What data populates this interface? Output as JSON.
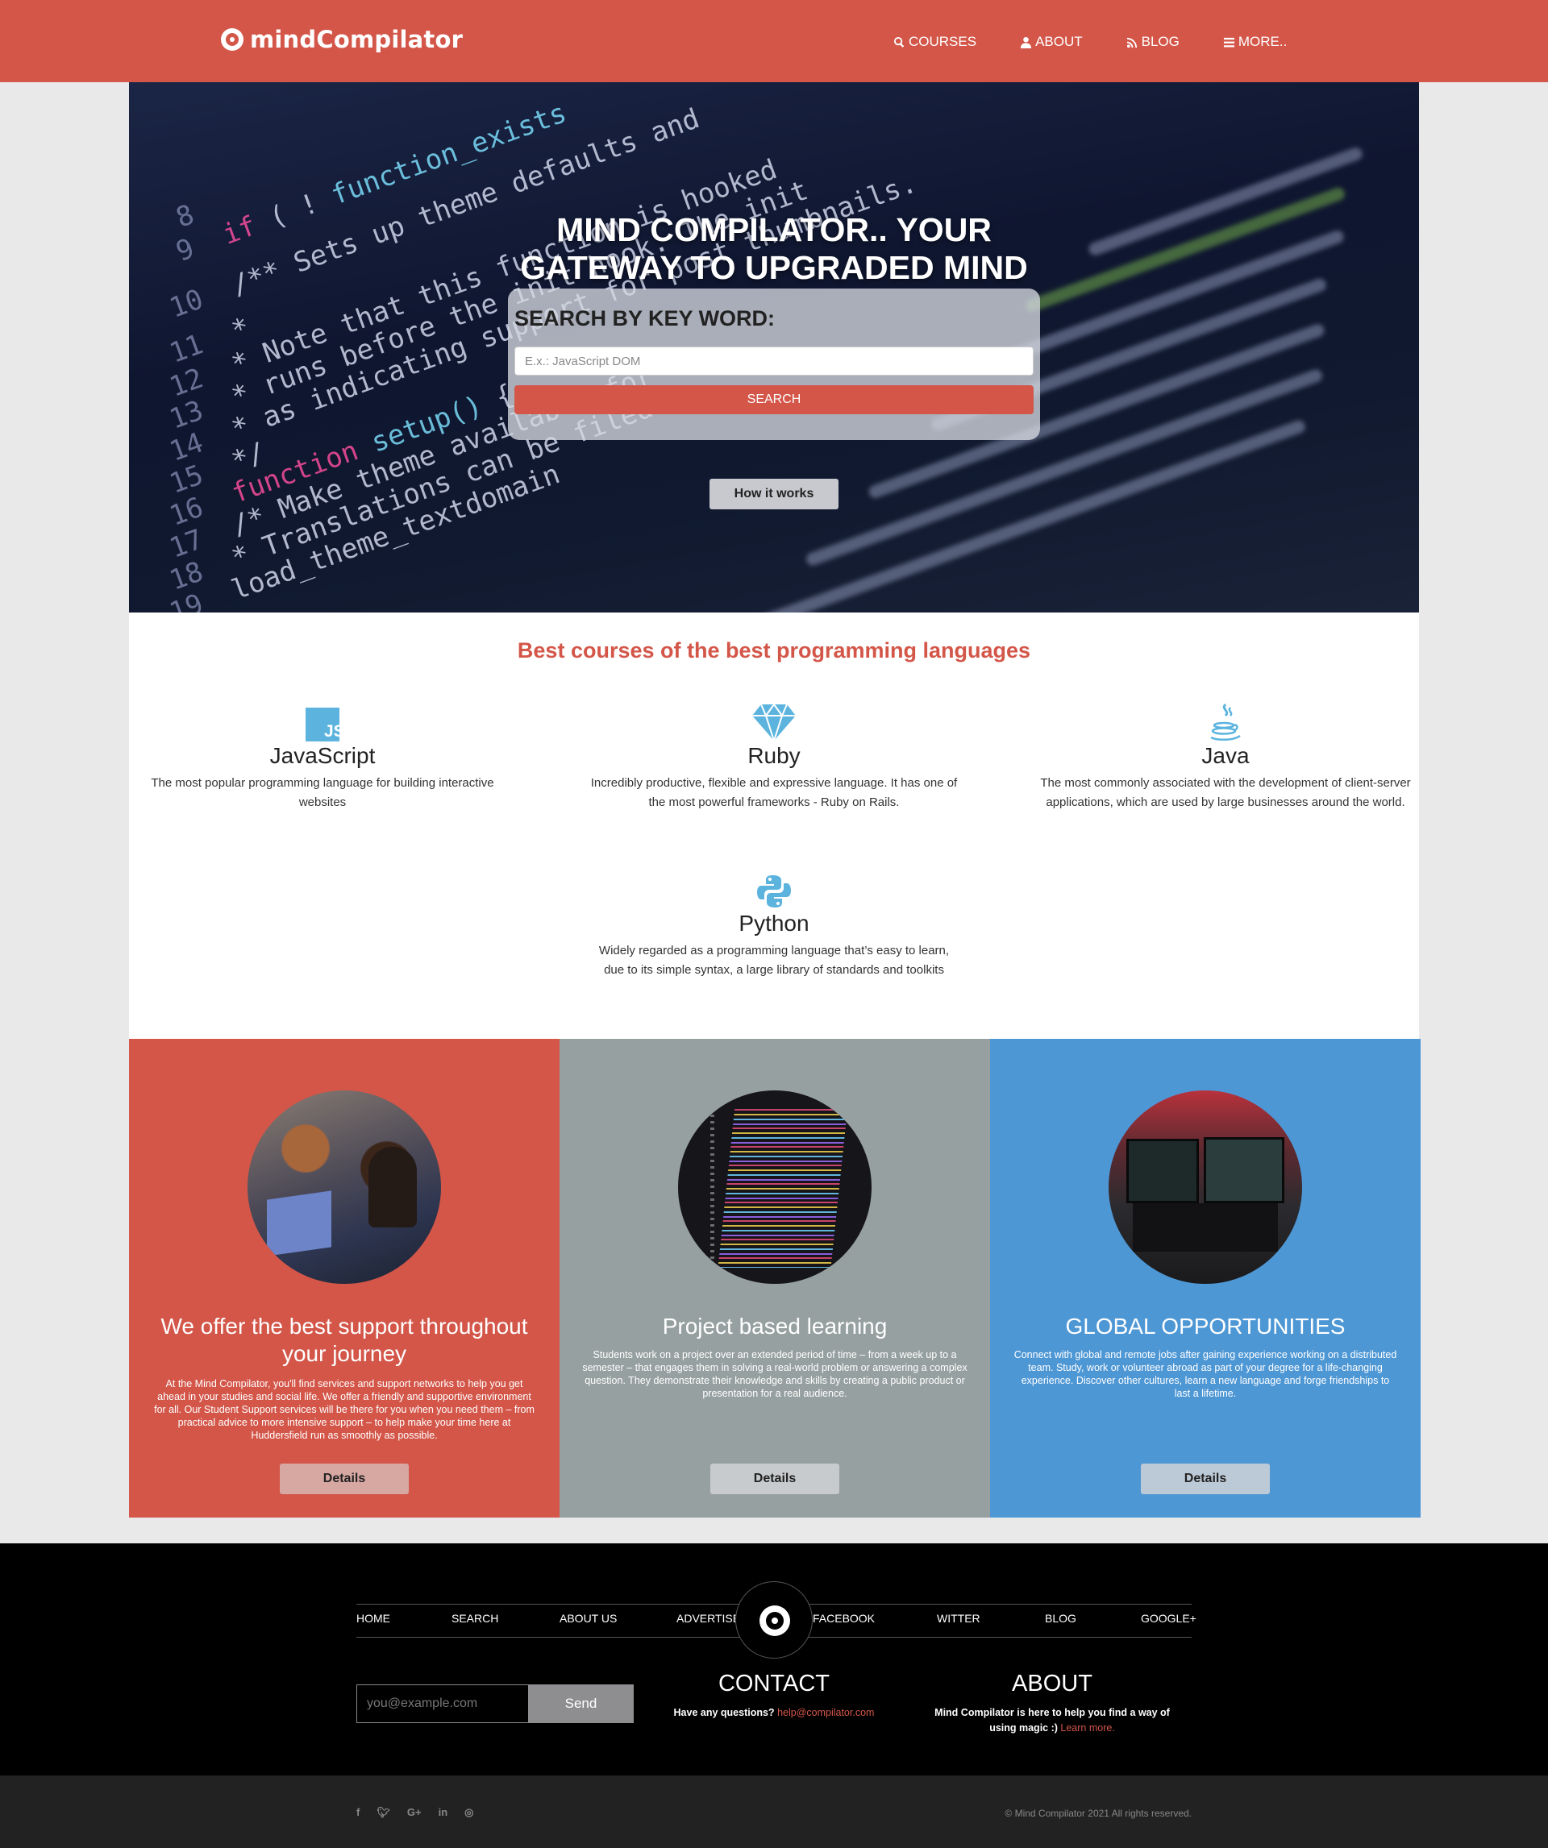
{
  "brand": {
    "name": "mindCompilator",
    "accent": "#d35649",
    "grey": "#97a0a0",
    "blue": "#4e97d5"
  },
  "nav": [
    {
      "label": "COURSES",
      "icon": "search-icon"
    },
    {
      "label": "ABOUT",
      "icon": "user-icon"
    },
    {
      "label": "BLOG",
      "icon": "rss-icon"
    },
    {
      "label": "MORE..",
      "icon": "menu-icon"
    }
  ],
  "hero": {
    "title_line1": "MIND COMPILATOR.. YOUR",
    "title_line2": "GATEWAY TO UPGRADED MIND",
    "search_label": "SEARCH BY KEY WORD:",
    "search_placeholder": "E.x.: JavaScript DOM",
    "search_button": "SEARCH",
    "how_button": "How it works"
  },
  "courses": {
    "title": "Best courses of the best programming languages",
    "items": [
      {
        "name": "JavaScript",
        "icon": "javascript-icon",
        "desc": "The most popular programming language for building interactive websites"
      },
      {
        "name": "Ruby",
        "icon": "ruby-gem-icon",
        "desc": "Incredibly productive, flexible and expressive language. It has one of the most powerful frameworks - Ruby on Rails."
      },
      {
        "name": "Java",
        "icon": "java-cup-icon",
        "desc": "The most commonly associated with the development of client-server applications, which are used by large businesses around the world."
      },
      {
        "name": "Python",
        "icon": "python-icon",
        "desc": "Widely regarded as a programming language that’s easy to learn, due to its simple syntax, a large library of standards and toolkits"
      }
    ]
  },
  "features": [
    {
      "title": "We offer the best support throughout your journey",
      "text": "At the Mind Compilator, you'll find services and support networks to help you get ahead in your studies and social life. We offer a friendly and supportive environment for all. Our Student Support services will be there for you when you need them – from practical advice to more intensive support – to help make your time here at Huddersfield run as smoothly as possible.",
      "button": "Details",
      "color": "#d35649"
    },
    {
      "title": "Project based learning",
      "text": "Students work on a project over an extended period of time – from a week up to a semester – that engages them in solving a real-world problem or answering a complex question. They demonstrate their knowledge and skills by creating a public product or presentation for a real audience.",
      "button": "Details",
      "color": "#97a0a0"
    },
    {
      "title": "GLOBAL OPPORTUNITIES",
      "text": "Connect with global and remote jobs after gaining experience working on a distributed team. Study, work or volunteer abroad as part of your degree for a life-changing experience. Discover other cultures, learn a new language and forge friendships to last a lifetime.",
      "button": "Details",
      "color": "#4e97d5"
    }
  ],
  "footer": {
    "links": [
      "HOME",
      "SEARCH",
      "ABOUT US",
      "ADVERTISE",
      "FACEBOOK",
      "WITTER",
      "BLOG",
      "GOOGLE+"
    ],
    "email_placeholder": "you@example.com",
    "send_button": "Send",
    "contact": {
      "title": "CONTACT",
      "text": "Have any questions?",
      "link": "help@compilator.com"
    },
    "about": {
      "title": "ABOUT",
      "text": "Mind Compilator is here to help you find a way of using magic :)",
      "link": "Learn more."
    },
    "social": [
      "facebook-icon",
      "twitter-icon",
      "google-plus-icon",
      "linkedin-icon",
      "instagram-icon"
    ],
    "copyright": "© Mind Compilator 2021 All rights reserved."
  }
}
